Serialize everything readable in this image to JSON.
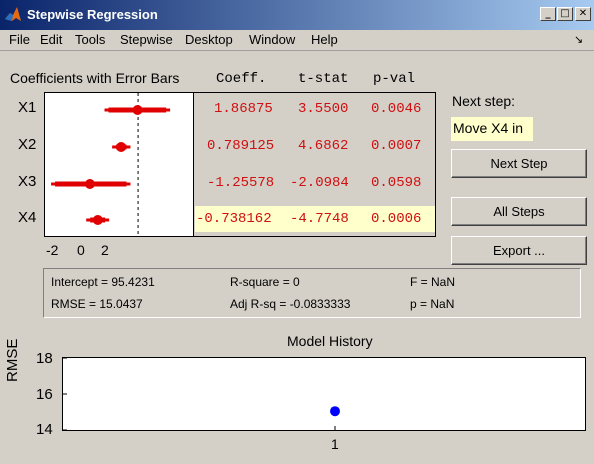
{
  "window": {
    "title": "Stepwise Regression",
    "icon": "matlab-icon",
    "controls": [
      "_",
      "□",
      "✕"
    ]
  },
  "menubar": {
    "items": [
      "File",
      "Edit",
      "Tools",
      "Stepwise",
      "Desktop",
      "Window",
      "Help"
    ],
    "dock_arrow": "↘"
  },
  "coefficients": {
    "title": "Coefficients with Error Bars",
    "columns": [
      "Coeff.",
      "t-stat",
      "p-val"
    ],
    "rows": [
      {
        "name": "X1",
        "coeff": "1.86875",
        "tstat": "3.5500",
        "pval": "0.0046",
        "highlighted": false,
        "estimate": 1.86875,
        "ci_low": -0.3,
        "ci_high": 4.0
      },
      {
        "name": "X2",
        "coeff": "0.789125",
        "tstat": "4.6862",
        "pval": "0.0007",
        "highlighted": false,
        "estimate": 0.789125,
        "ci_low": 0.2,
        "ci_high": 1.4
      },
      {
        "name": "X3",
        "coeff": "-1.25578",
        "tstat": "-2.0984",
        "pval": "0.0598",
        "highlighted": false,
        "estimate": -1.25578,
        "ci_low": -3.8,
        "ci_high": 1.4
      },
      {
        "name": "X4",
        "coeff": "-0.738162",
        "tstat": "-4.7748",
        "pval": "0.0006",
        "highlighted": true,
        "estimate": -0.738162,
        "ci_low": -1.5,
        "ci_high": 0.0
      }
    ],
    "axis_ticks": [
      "-2",
      "0",
      "2"
    ],
    "axis_range": [
      -4.2,
      5.5
    ],
    "reference_line": 1.9,
    "colors": {
      "in_model": "#e00000",
      "value_text": "#d01010",
      "highlight": "#ffffcc"
    }
  },
  "next_step": {
    "label": "Next step:",
    "value": "Move X4 in"
  },
  "buttons": {
    "next_step": "Next Step",
    "all_steps": "All Steps",
    "export": "Export ..."
  },
  "stats": {
    "intercept": "Intercept = 95.4231",
    "rsquare": "R-square = 0",
    "f": "F = NaN",
    "rmse": "RMSE = 15.0437",
    "adj_rsq": "Adj R-sq = -0.0833333",
    "p": "p = NaN"
  },
  "history": {
    "title": "Model History",
    "ylabel": "RMSE",
    "yticks": [
      "18",
      "16",
      "14"
    ],
    "xticks": [
      "1"
    ],
    "point_color": "#0000ff"
  },
  "chart_data": {
    "type": "scatter",
    "title": "Model History",
    "xlabel": "",
    "ylabel": "RMSE",
    "x": [
      1
    ],
    "y": [
      15.0437
    ],
    "ylim": [
      14,
      18
    ],
    "grid": false
  }
}
